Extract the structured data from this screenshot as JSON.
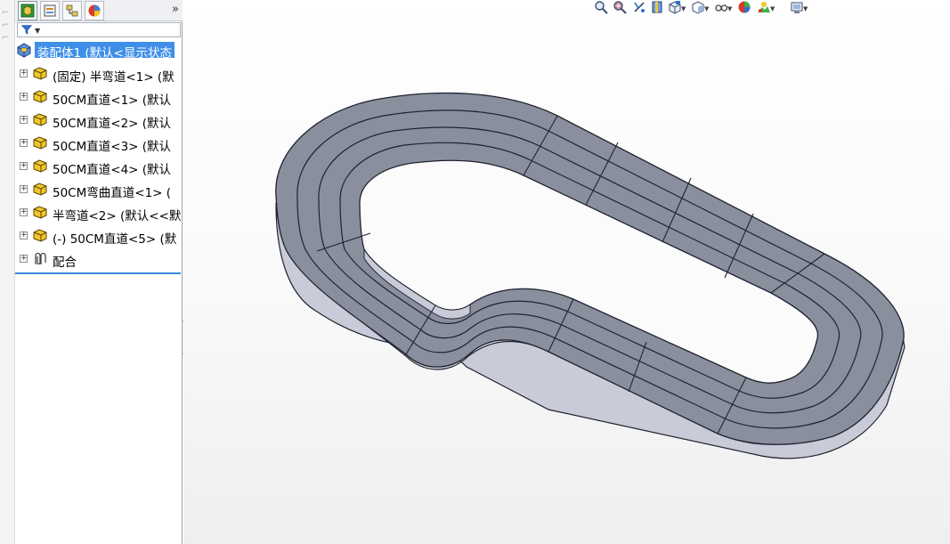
{
  "panel": {
    "tabs": [
      "feature-manager",
      "property-manager",
      "configuration-manager",
      "display-manager"
    ],
    "more_label": "»",
    "filter_icon": "filter-icon"
  },
  "tree": {
    "root": {
      "label": "装配体1  (默认<显示状态",
      "icon": "assembly-icon"
    },
    "items": [
      {
        "label": "(固定) 半弯道<1> (默",
        "icon": "part-icon"
      },
      {
        "label": "50CM直道<1> (默认",
        "icon": "part-icon"
      },
      {
        "label": "50CM直道<2> (默认",
        "icon": "part-icon"
      },
      {
        "label": "50CM直道<3> (默认",
        "icon": "part-icon"
      },
      {
        "label": "50CM直道<4> (默认",
        "icon": "part-icon"
      },
      {
        "label": "50CM弯曲直道<1> (",
        "icon": "part-icon"
      },
      {
        "label": "半弯道<2> (默认<<默",
        "icon": "part-icon"
      },
      {
        "label": "(-) 50CM直道<5> (默",
        "icon": "part-icon"
      },
      {
        "label": "配合",
        "icon": "mates-icon"
      }
    ]
  },
  "toolbar": {
    "items": [
      "zoom-to-fit-icon",
      "zoom-to-area-icon",
      "previous-view-icon",
      "section-view-icon",
      "view-orientation-icon",
      "display-style-icon",
      "hide-show-items-icon",
      "edit-appearance-icon",
      "apply-scene-icon",
      "view-settings-icon"
    ]
  },
  "colors": {
    "track_top": "#8a8f9e",
    "track_side": "#c9ccd8",
    "selection": "#3f8fe8"
  }
}
